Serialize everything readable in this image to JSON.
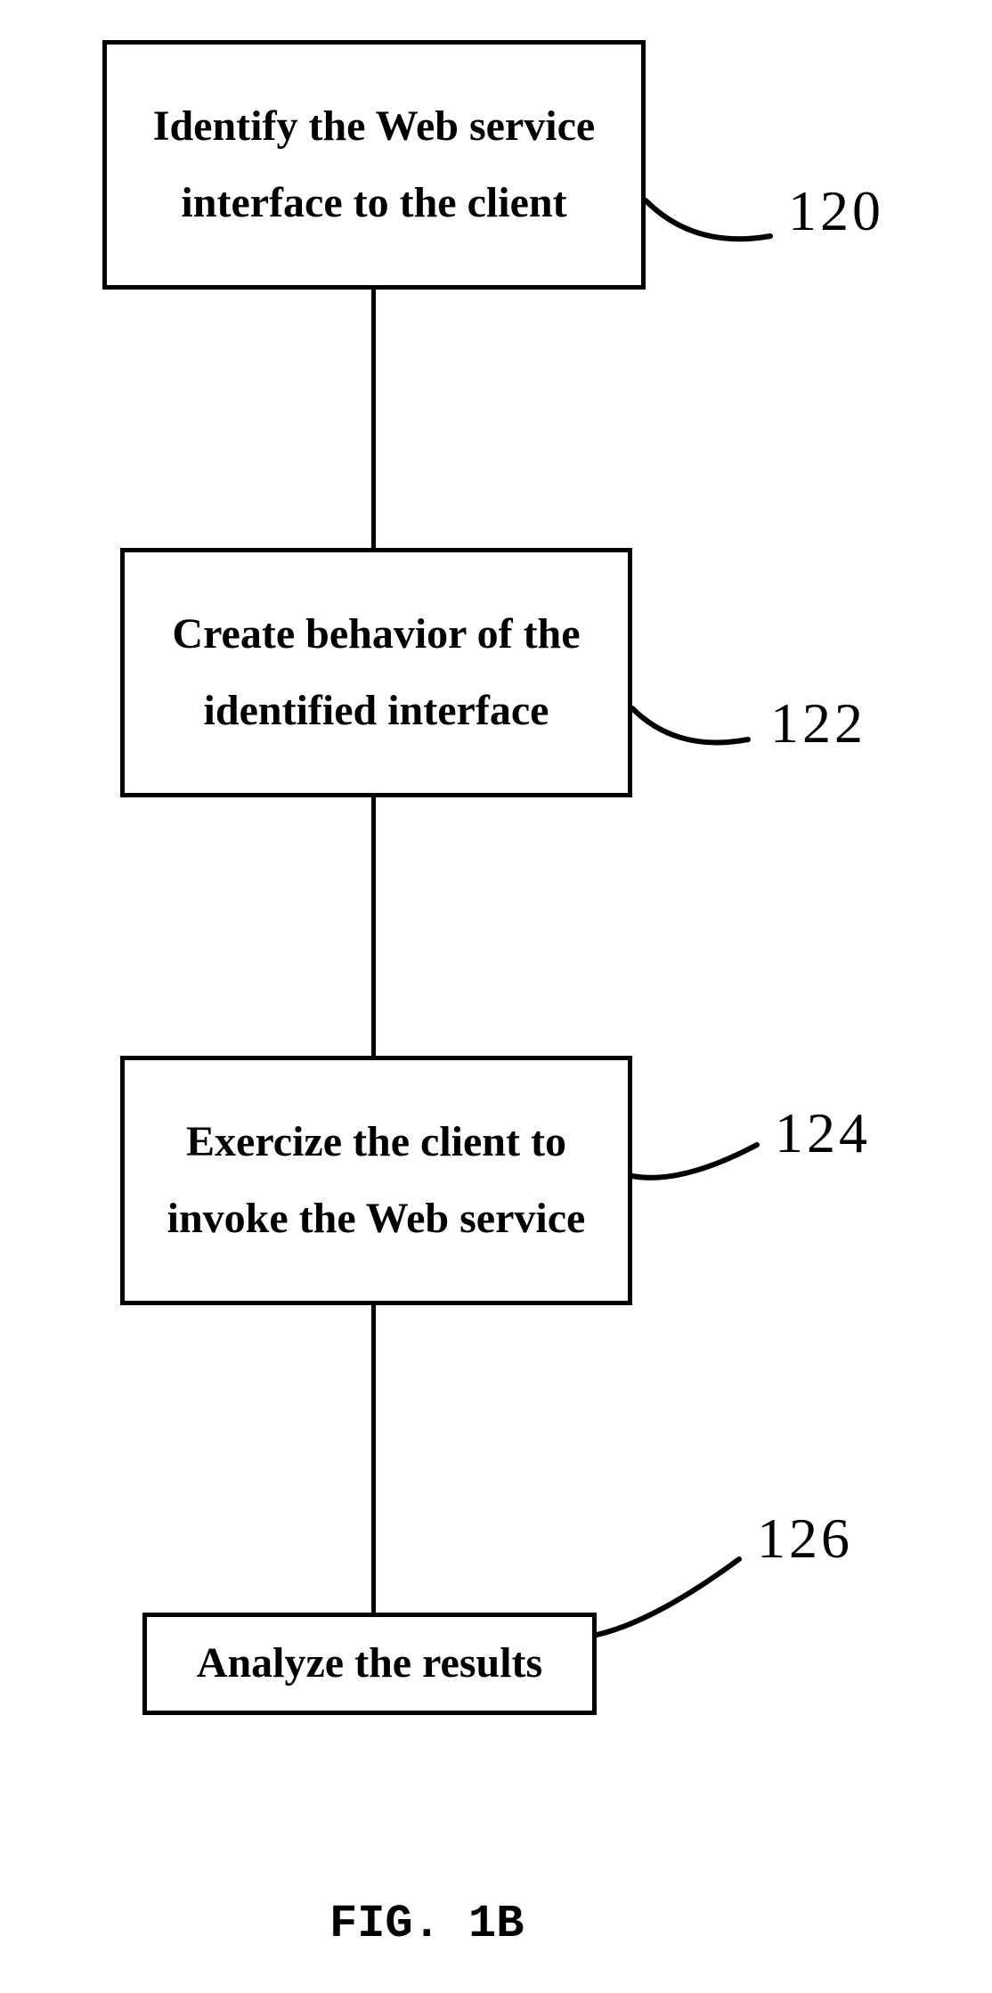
{
  "figure_caption": "FIG. 1B",
  "steps": [
    {
      "text": "Identify the Web service interface to the client",
      "label": "120"
    },
    {
      "text": "Create behavior of the identified interface",
      "label": "122"
    },
    {
      "text": "Exercize the client to invoke the Web service",
      "label": "124"
    },
    {
      "text": "Analyze the results",
      "label": "126"
    }
  ]
}
